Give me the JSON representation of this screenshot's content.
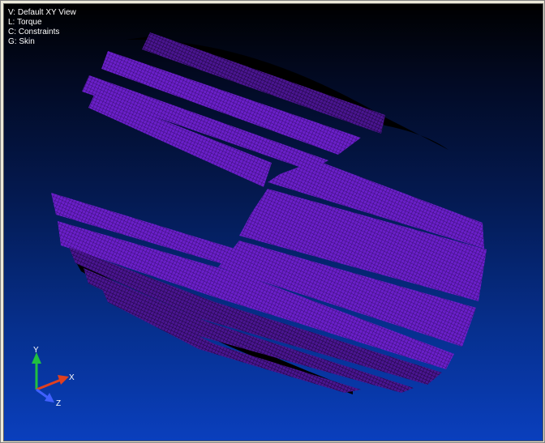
{
  "viewport": {
    "info_lines": {
      "view": "V: Default XY View",
      "load": "L: Torque",
      "constraints": "C: Constraints",
      "group": "G: Skin"
    },
    "triad": {
      "x_label": "X",
      "y_label": "Y",
      "z_label": "Z"
    },
    "colors": {
      "mesh": "#6a1fc9",
      "mesh_lines": "#2a0a55",
      "shadow": "#000000",
      "background_top": "#000000",
      "background_bottom": "#0a3fbd",
      "x_axis": "#e04020",
      "y_axis": "#20c040",
      "z_axis": "#4060ff"
    }
  }
}
